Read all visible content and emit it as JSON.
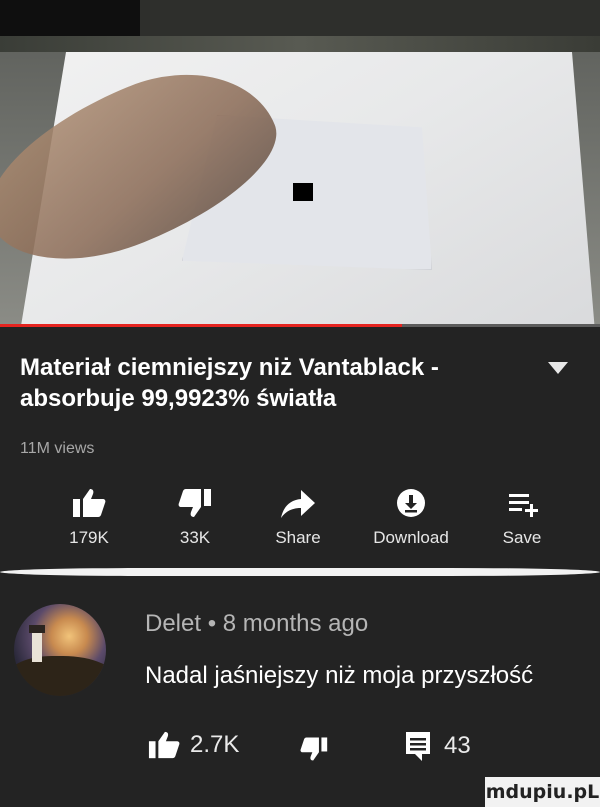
{
  "video": {
    "progress": 0.67
  },
  "title": "Materiał ciemniejszy niż Vantablack - absorbuje 99,9923% światła",
  "views": "11M views",
  "actions": [
    {
      "icon": "thumbs-up-icon",
      "label": "179K"
    },
    {
      "icon": "thumbs-down-icon",
      "label": "33K"
    },
    {
      "icon": "share-icon",
      "label": "Share"
    },
    {
      "icon": "download-icon",
      "label": "Download"
    },
    {
      "icon": "save-playlist-icon",
      "label": "Save"
    }
  ],
  "comment": {
    "author": "Delet",
    "separator": "•",
    "time": "8 months ago",
    "text": "Nadal jaśniejszy niż moja przyszłość",
    "likes": "2.7K",
    "replies": "43"
  },
  "watermark": "mdupiu.pL"
}
